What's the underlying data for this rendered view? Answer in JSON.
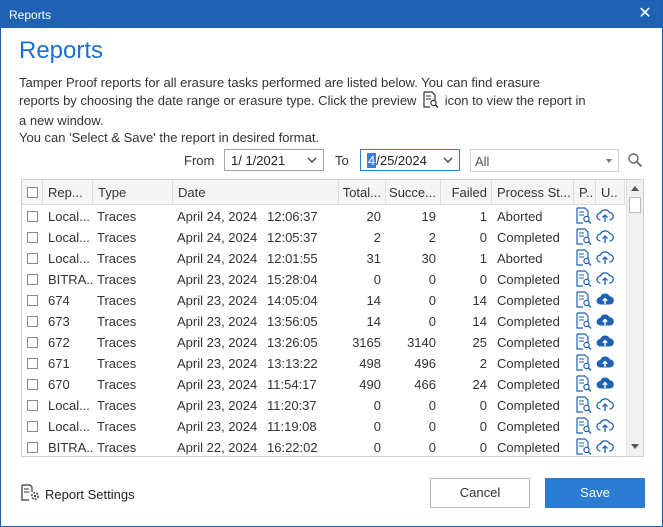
{
  "window": {
    "title": "Reports",
    "close_glyph": "✕"
  },
  "heading": "Reports",
  "description": {
    "line1": "Tamper Proof reports for all erasure tasks performed are listed below. You can find erasure",
    "line2a": "reports by choosing the date range or erasure type. Click the preview",
    "line2b": "icon to view the report in",
    "line3": "a new window.",
    "line4": "You can 'Select & Save' the report in desired format."
  },
  "filters": {
    "from_label": "From",
    "from_value": "1/  1/2021",
    "to_label": "To",
    "to_value_selected": "4",
    "to_value_rest": "/25/2024",
    "type_value": "All"
  },
  "columns": [
    "Rep...",
    "Type",
    "Date",
    "Total...",
    "Succe...",
    "Failed",
    "Process St...",
    "P..",
    "U.."
  ],
  "rows": [
    {
      "report": "Local...",
      "type": "Traces",
      "date": "April 24, 2024",
      "time": "12:06:37",
      "total": "20",
      "success": "19",
      "failed": "1",
      "status": "Aborted",
      "upload": "outline"
    },
    {
      "report": "Local...",
      "type": "Traces",
      "date": "April 24, 2024",
      "time": "12:05:37",
      "total": "2",
      "success": "2",
      "failed": "0",
      "status": "Completed",
      "upload": "outline"
    },
    {
      "report": "Local...",
      "type": "Traces",
      "date": "April 24, 2024",
      "time": "12:01:55",
      "total": "31",
      "success": "30",
      "failed": "1",
      "status": "Aborted",
      "upload": "outline"
    },
    {
      "report": "BITRA...",
      "type": "Traces",
      "date": "April 23, 2024",
      "time": "15:28:04",
      "total": "0",
      "success": "0",
      "failed": "0",
      "status": "Completed",
      "upload": "outline"
    },
    {
      "report": "674",
      "type": "Traces",
      "date": "April 23, 2024",
      "time": "14:05:04",
      "total": "14",
      "success": "0",
      "failed": "14",
      "status": "Completed",
      "upload": "filled"
    },
    {
      "report": "673",
      "type": "Traces",
      "date": "April 23, 2024",
      "time": "13:56:05",
      "total": "14",
      "success": "0",
      "failed": "14",
      "status": "Completed",
      "upload": "filled"
    },
    {
      "report": "672",
      "type": "Traces",
      "date": "April 23, 2024",
      "time": "13:26:05",
      "total": "3165",
      "success": "3140",
      "failed": "25",
      "status": "Completed",
      "upload": "filled"
    },
    {
      "report": "671",
      "type": "Traces",
      "date": "April 23, 2024",
      "time": "13:13:22",
      "total": "498",
      "success": "496",
      "failed": "2",
      "status": "Completed",
      "upload": "filled"
    },
    {
      "report": "670",
      "type": "Traces",
      "date": "April 23, 2024",
      "time": "11:54:17",
      "total": "490",
      "success": "466",
      "failed": "24",
      "status": "Completed",
      "upload": "filled"
    },
    {
      "report": "Local...",
      "type": "Traces",
      "date": "April 23, 2024",
      "time": "11:20:37",
      "total": "0",
      "success": "0",
      "failed": "0",
      "status": "Completed",
      "upload": "outline"
    },
    {
      "report": "Local...",
      "type": "Traces",
      "date": "April 23, 2024",
      "time": "11:19:08",
      "total": "0",
      "success": "0",
      "failed": "0",
      "status": "Completed",
      "upload": "outline"
    },
    {
      "report": "BITRA...",
      "type": "Traces",
      "date": "April 22, 2024",
      "time": "16:22:02",
      "total": "0",
      "success": "0",
      "failed": "0",
      "status": "Completed",
      "upload": "outline"
    }
  ],
  "footer": {
    "settings_label": "Report Settings",
    "cancel_label": "Cancel",
    "save_label": "Save"
  },
  "colors": {
    "accent": "#2b7cd3",
    "titlebar": "#1f62b3",
    "heading": "#1f6fd1"
  },
  "icons": {
    "preview": "preview-report-icon",
    "upload": "cloud-upload-icon",
    "search": "search-icon",
    "settings": "report-settings-icon",
    "calendar": "chevron-down-icon"
  }
}
